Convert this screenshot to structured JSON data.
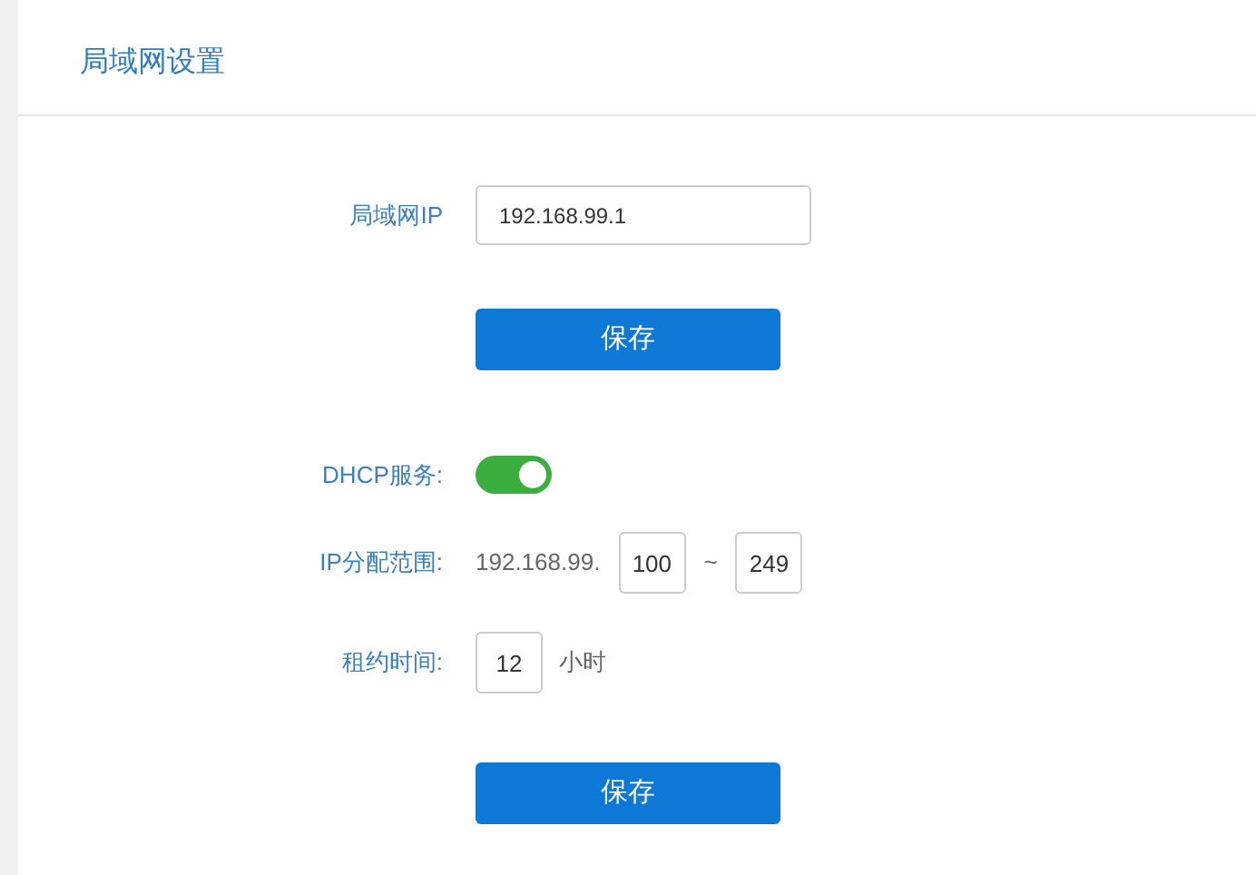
{
  "page_title": "局域网设置",
  "lan_section": {
    "ip_label": "局域网IP",
    "ip_value": "192.168.99.1",
    "save_button": "保存"
  },
  "dhcp_section": {
    "dhcp_label": "DHCP服务:",
    "dhcp_on": true,
    "range_label": "IP分配范围:",
    "range_prefix": "192.168.99.",
    "range_start": "100",
    "range_separator": "~",
    "range_end": "249",
    "lease_label": "租约时间:",
    "lease_value": "12",
    "lease_unit": "小时",
    "save_button": "保存"
  }
}
